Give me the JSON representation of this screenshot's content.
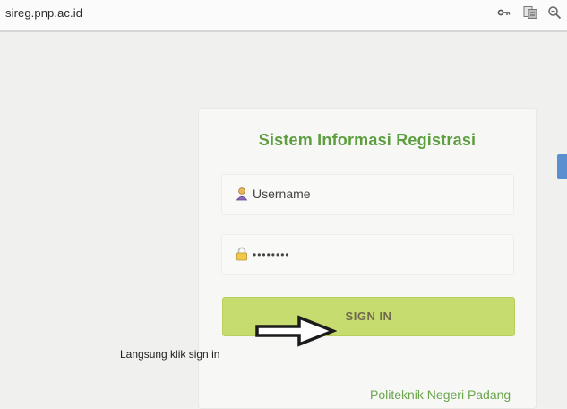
{
  "browser": {
    "url": "sireg.pnp.ac.id",
    "icons": [
      "key-icon",
      "translate-icon",
      "zoom-icon"
    ]
  },
  "login": {
    "title": "Sistem Informasi Registrasi",
    "username_placeholder": "Username",
    "password_value": "••••••••",
    "signin_label": "SIGN IN",
    "footer": "Politeknik Negeri Padang"
  },
  "annotation": {
    "text": "Langsung klik sign in"
  },
  "colors": {
    "title": "#5d9e3f",
    "button": "#c6dc6f",
    "footer": "#6aa54b"
  }
}
